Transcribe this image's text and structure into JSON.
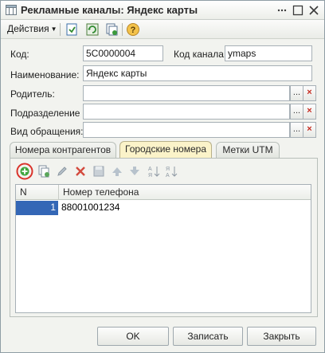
{
  "window": {
    "title": "Рекламные каналы: Яндекс карты"
  },
  "toolbar": {
    "actions_label": "Действия",
    "help_glyph": "?",
    "icons": [
      "save-record-icon",
      "refresh-icon",
      "copy-icon",
      "help-icon"
    ]
  },
  "form": {
    "code_label": "Код:",
    "code_value": "5С0000004",
    "channel_code_label": "Код канала:",
    "channel_code_value": "ymaps",
    "name_label": "Наименование:",
    "name_value": "Яндекс карты",
    "parent_label": "Родитель:",
    "parent_value": "",
    "division_label": "Подразделение ...",
    "division_value": "",
    "appeal_type_label": "Вид обращения:",
    "appeal_type_value": "",
    "select_glyph": "...",
    "clear_glyph": "×"
  },
  "tabs": [
    {
      "label": "Номера контрагентов",
      "active": false
    },
    {
      "label": "Городские номера",
      "active": true
    },
    {
      "label": "Метки UTM",
      "active": false
    }
  ],
  "table": {
    "columns": [
      "N",
      "Номер телефона"
    ],
    "rows": [
      {
        "n": "1",
        "phone": "88001001234"
      }
    ],
    "toolbar_icons": [
      "add-icon",
      "copy-row-icon",
      "edit-icon",
      "delete-icon",
      "end-edit-icon",
      "move-up-icon",
      "move-down-icon",
      "sort-asc-icon",
      "sort-desc-icon"
    ],
    "highlight_color": "#d9332b"
  },
  "buttons": {
    "ok": "OK",
    "save": "Записать",
    "close": "Закрыть"
  },
  "colors": {
    "active_tab": "#fbf3c9",
    "selected_cell": "#3467b6",
    "clear_x": "#c62b20"
  }
}
